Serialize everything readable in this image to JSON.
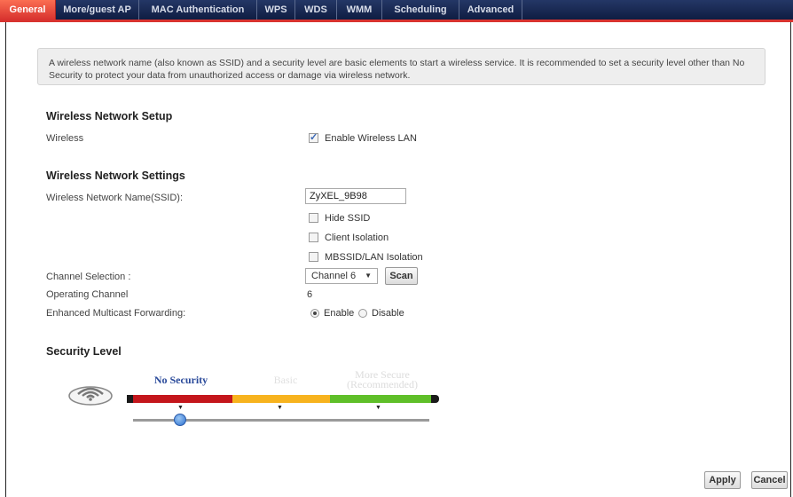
{
  "tabs": [
    {
      "label": "General",
      "active": true
    },
    {
      "label": "More/guest AP",
      "active": false
    },
    {
      "label": "MAC Authentication",
      "active": false
    },
    {
      "label": "WPS",
      "active": false
    },
    {
      "label": "WDS",
      "active": false
    },
    {
      "label": "WMM",
      "active": false
    },
    {
      "label": "Scheduling",
      "active": false
    },
    {
      "label": "Advanced",
      "active": false
    }
  ],
  "info_text": "A wireless network name (also known as SSID) and a security level are basic elements to start a wireless service. It is recommended to set a security level other than No Security to protect your data from unauthorized access or damage via wireless network.",
  "setup": {
    "title": "Wireless Network Setup",
    "wireless_label": "Wireless",
    "enable_wlan_label": "Enable Wireless LAN",
    "enable_wlan_checked": true
  },
  "settings": {
    "title": "Wireless Network Settings",
    "ssid_label": "Wireless Network Name(SSID):",
    "ssid_value": "ZyXEL_9B98",
    "hide_ssid_label": "Hide SSID",
    "client_isolation_label": "Client Isolation",
    "mbssid_isolation_label": "MBSSID/LAN Isolation",
    "channel_label": "Channel Selection :",
    "channel_value": "Channel 6",
    "scan_label": "Scan",
    "operating_channel_label": "Operating Channel",
    "operating_channel_value": "6",
    "multicast_label": "Enhanced Multicast Forwarding:",
    "enable_label": "Enable",
    "disable_label": "Disable",
    "multicast_enabled": true
  },
  "security": {
    "title": "Security Level",
    "levels": [
      "No Security",
      "Basic",
      "More Secure\n(Recommended)"
    ],
    "selected_index": 0,
    "colors": {
      "no_security": "#c4161c",
      "basic": "#f7b31e",
      "more_secure": "#5fbf29"
    }
  },
  "buttons": {
    "apply": "Apply",
    "cancel": "Cancel"
  }
}
